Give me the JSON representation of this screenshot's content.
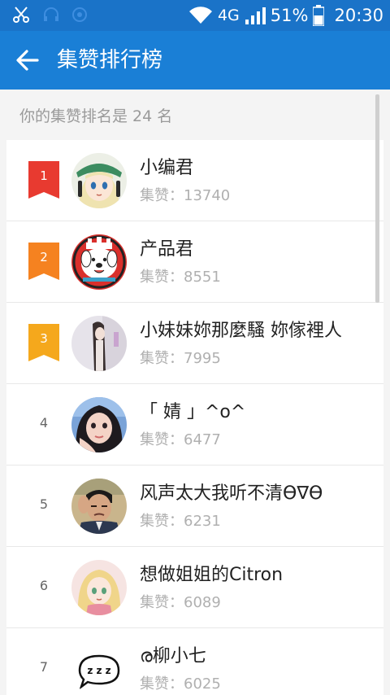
{
  "status_bar": {
    "network": "4G",
    "battery": "51%",
    "time": "20:30"
  },
  "app_bar": {
    "title": "集赞排行榜"
  },
  "summary": "你的集赞排名是 24 名",
  "colors": {
    "status_bar": "#1a73c8",
    "app_bar": "#1a7fd6",
    "medal_1": "#e83a30",
    "medal_2": "#f58220",
    "medal_3": "#f5a81c"
  },
  "list": [
    {
      "rank": "1",
      "name": "小编君",
      "likes": "集赞：13740",
      "avatar": "anime-girl-green-hat"
    },
    {
      "rank": "2",
      "name": "产品君",
      "likes": "集赞：8551",
      "avatar": "white-dog-cartoon"
    },
    {
      "rank": "3",
      "name": "小妹妹妳那麼騷 妳傢裡人",
      "likes": "集赞：7995",
      "avatar": "pale-photo"
    },
    {
      "rank": "4",
      "name": "「 婧 」^o^",
      "likes": "集赞：6477",
      "avatar": "girl-selfie"
    },
    {
      "rank": "5",
      "name": "风声太大我听不清ϴ∇ϴ",
      "likes": "集赞：6231",
      "avatar": "man-hand-on-ear"
    },
    {
      "rank": "6",
      "name": "想做姐姐的Citron",
      "likes": "集赞：6089",
      "avatar": "anime-girl-blonde"
    },
    {
      "rank": "7",
      "name": "ര柳小七",
      "likes": "集赞：6025",
      "avatar": "zzz-sleep-bubble"
    }
  ]
}
